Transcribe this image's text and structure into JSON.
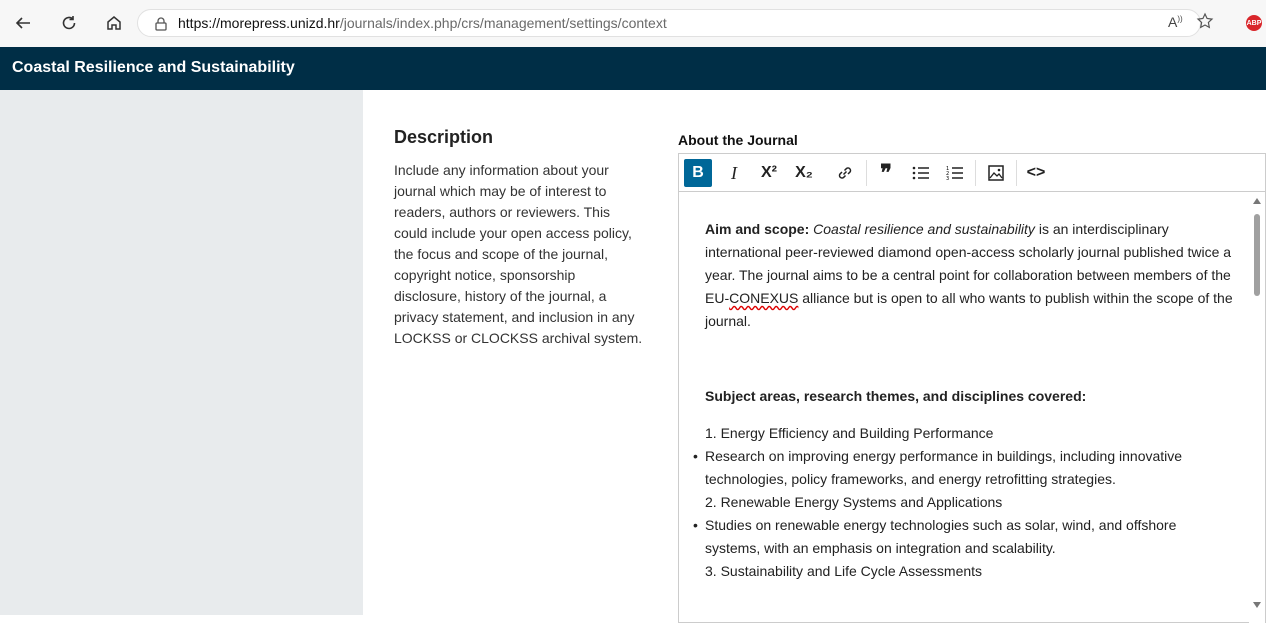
{
  "browser": {
    "url_host": "https://morepress.unizd.hr",
    "url_path": "/journals/index.php/crs/management/settings/context",
    "read_aloud_label": "A",
    "icons": [
      "back-icon",
      "refresh-icon",
      "home-icon",
      "lock-icon",
      "read-aloud-icon",
      "favorite-star-icon",
      "adblock-icon"
    ],
    "abp_label": "ABP"
  },
  "site": {
    "title": "Coastal Resilience and Sustainability",
    "header_color": "#002e46"
  },
  "description": {
    "heading": "Description",
    "text": "Include any information about your journal which may be of interest to readers, authors or reviewers. This could include your open access policy, the focus and scope of the journal, copyright notice, sponsorship disclosure, history of the journal, a privacy statement, and inclusion in any LOCKSS or CLOCKSS archival system."
  },
  "editor": {
    "label": "About the Journal",
    "toolbar": [
      {
        "name": "bold",
        "glyph": "B"
      },
      {
        "name": "italic",
        "glyph": "I"
      },
      {
        "name": "superscript",
        "glyph": "X²"
      },
      {
        "name": "subscript",
        "glyph": "X₂"
      },
      {
        "name": "link",
        "glyph": "🔗"
      },
      {
        "name": "blockquote",
        "glyph": "❞"
      },
      {
        "name": "bullet-list",
        "glyph": "☰"
      },
      {
        "name": "numbered-list",
        "glyph": "☰"
      },
      {
        "name": "image",
        "glyph": "▣"
      },
      {
        "name": "code",
        "glyph": "<>"
      }
    ],
    "content": {
      "aim_label": "Aim and scope:",
      "aim_italic": "Coastal resilience and sustainability",
      "aim_text_1": " is an interdisciplinary international peer-reviewed diamond open-access scholarly journal published twice a year. The journal aims to be a central point for collaboration between members of the EU-",
      "aim_spell": "CONEXUS",
      "aim_text_2": " alliance but is open to all who wants to publish within the scope of the journal.",
      "subject_heading": "Subject areas, research themes, and disciplines covered:",
      "item1": "1. Energy Efficiency and Building Performance",
      "bullet1": "Research on improving energy performance in buildings, including innovative technologies, policy frameworks, and energy retrofitting strategies.",
      "item2": "2. Renewable Energy Systems and Applications",
      "bullet2": "Studies on renewable energy technologies such as solar, wind, and offshore systems, with an emphasis on integration and scalability.",
      "item3": "3. Sustainability and Life Cycle Assessments"
    },
    "active_color": "#006798"
  }
}
